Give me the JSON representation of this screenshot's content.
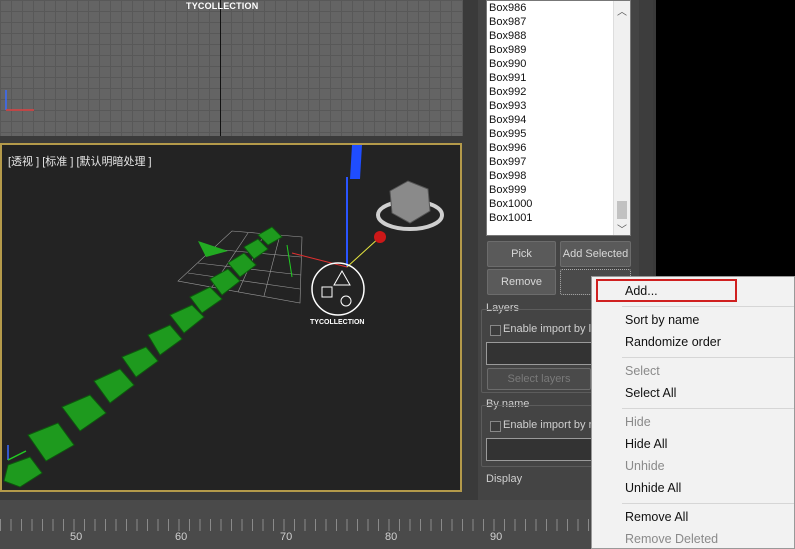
{
  "viewport_top": {
    "watermark": "TYCOLLECTION"
  },
  "viewport_persp": {
    "label": "[透视 ] [标准 ] [默认明暗处理 ]",
    "watermark": "TYCOLLECTION"
  },
  "object_list": [
    "Box986",
    "Box987",
    "Box988",
    "Box989",
    "Box990",
    "Box991",
    "Box992",
    "Box993",
    "Box994",
    "Box995",
    "Box996",
    "Box997",
    "Box998",
    "Box999",
    "Box1000",
    "Box1001"
  ],
  "buttons": {
    "pick": "Pick",
    "add_selected": "Add Selected",
    "remove": "Remove"
  },
  "layers": {
    "title": "Layers",
    "enable_label": "Enable import by la",
    "select_layers": "Select layers"
  },
  "by_name": {
    "title": "By name",
    "enable_label": "Enable import by n"
  },
  "display": {
    "title": "Display"
  },
  "timeline": {
    "ticks": [
      "50",
      "60",
      "70",
      "80",
      "90"
    ]
  },
  "context_menu": {
    "add": "Add...",
    "sort_by_name": "Sort by name",
    "randomize_order": "Randomize order",
    "select": "Select",
    "select_all": "Select All",
    "hide": "Hide",
    "hide_all": "Hide All",
    "unhide": "Unhide",
    "unhide_all": "Unhide All",
    "remove_all": "Remove All",
    "remove_deleted": "Remove Deleted"
  },
  "colors": {
    "viewport_border": "#b49a4a",
    "highlight": "#d02020",
    "green_box": "#1e9a1e"
  }
}
